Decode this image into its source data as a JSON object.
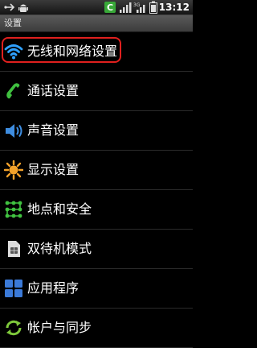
{
  "status_bar": {
    "time": "13:12",
    "icons": [
      "usb-icon",
      "android-debug-icon",
      "carrier-c-icon",
      "signal-icon",
      "3g-signal-icon",
      "battery-icon"
    ]
  },
  "title_bar": {
    "title": "设置"
  },
  "settings_items": [
    {
      "label": "无线和网络设置",
      "icon": "wifi-icon",
      "color": "#2fa0ff"
    },
    {
      "label": "通话设置",
      "icon": "phone-icon",
      "color": "#3fbf3f"
    },
    {
      "label": "声音设置",
      "icon": "speaker-icon",
      "color": "#3e8de0"
    },
    {
      "label": "显示设置",
      "icon": "brightness-icon",
      "color": "#f3a22a"
    },
    {
      "label": "地点和安全",
      "icon": "location-security-icon",
      "color": "#41c341"
    },
    {
      "label": "双待机模式",
      "icon": "sim-card-icon",
      "color": "#dddddd"
    },
    {
      "label": "应用程序",
      "icon": "apps-icon",
      "color": "#3b7ad8"
    },
    {
      "label": "帐户与同步",
      "icon": "sync-icon",
      "color": "#7ec93b"
    }
  ],
  "highlight_color": "#e0201e"
}
